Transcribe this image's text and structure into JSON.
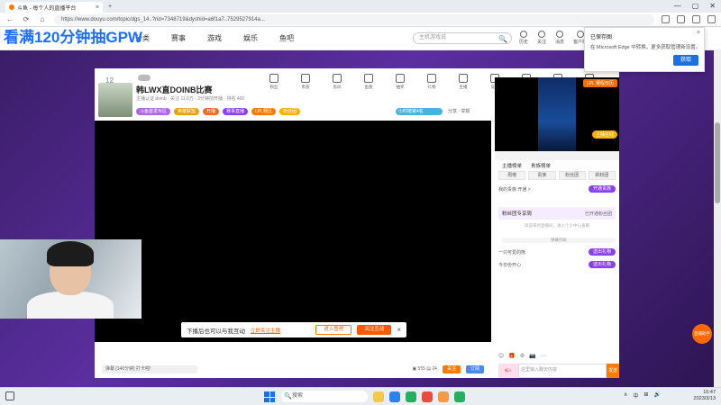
{
  "browser": {
    "tab_title": "斗鱼 - 每个人的直播平台",
    "new_tab": "+",
    "tab_close": "×",
    "url": "https://www.douyu.com/topic/dgs_14..?rid=7348719&dyshid=a6f1a7..7529527914a...",
    "nav": {
      "back": "←",
      "refresh": "⟳",
      "home": "⌂"
    },
    "window_controls": [
      "—",
      "▢",
      "✕"
    ]
  },
  "overlay_title": "看满120分钟抽GPW",
  "site": {
    "nav": [
      "分类",
      "赛事",
      "游戏",
      "娱乐",
      "鱼吧"
    ],
    "search_placeholder": "主机游戏说",
    "search_icon": "🔍",
    "header_icons": [
      "历史",
      "关注",
      "消息",
      "客户端",
      "登录"
    ]
  },
  "notification": {
    "title": "已保存图",
    "body": "在 Microsoft Edge 中转换，更多获取管理新设置。",
    "button": "获取",
    "close": "×"
  },
  "room": {
    "level": "12",
    "title": "韩LWX直DOINB比赛",
    "meta": "主播认证 doinb · 关注 11.6万 · 2分钟前开播 · 排名 400",
    "tags": [
      {
        "label": "斗鱼首发专区",
        "color": "#b065e8"
      },
      {
        "label": "英雄联盟",
        "color": "#e8a017"
      },
      {
        "label": "开播",
        "color": "#f06a2a"
      },
      {
        "label": "赛事直播",
        "color": "#8a3ff0"
      },
      {
        "label": "LPL赛区",
        "color": "#ff7a00"
      },
      {
        "label": "粉丝团",
        "color": "#ffb000"
      }
    ],
    "tools": [
      "粉丝",
      "贵族",
      "房间",
      "鱼翅",
      "抽奖",
      "礼物",
      "主播",
      "竞猜",
      "精彩",
      "AR",
      "连麦"
    ],
    "rank_pill": "小时榜第4名",
    "share": "分享 · 举报",
    "popup": {
      "text": "下播后也可以与我互动",
      "link": "立即关注主播",
      "btn_outline": "进入鱼吧",
      "btn_fill": "关注互动",
      "close": "×"
    },
    "footer": {
      "left": "弹幕 [140分钟] 打卡啦!",
      "stats": "▣ 555  ▤ 24",
      "btn1": "关注",
      "btn2": "订阅"
    }
  },
  "side": {
    "top_badge": "LPL 赛程日历",
    "bottom_badge": "主播在线",
    "tabs_top": [
      "主播榜单",
      "贵族榜单"
    ],
    "tabs": [
      "周榜",
      "贵族",
      "粉丝团",
      "新粉团"
    ],
    "row1_text": "我的贵族 开通 >",
    "row1_btn": "开通贵族",
    "banner": "粉丝团专享周",
    "banner_right": "已开通粉丝团",
    "note": "欢迎来到直播间，进入个人中心查看",
    "note2": "弹幕列表",
    "chat_rows": [
      {
        "text": "一只可爱的熊",
        "btn": "送出礼物"
      },
      {
        "text": "今日份开心",
        "btn": "送出礼物"
      }
    ],
    "chat_tools": [
      "😊",
      "🎁",
      "⚙",
      "📷",
      "⋯"
    ],
    "chat_avatar": "新人",
    "chat_placeholder": "这里输入聊天内容",
    "send": "发送"
  },
  "float_button": "直播助手",
  "taskbar": {
    "search_placeholder": "搜索",
    "search_icon": "🔍",
    "apps": [
      "#f2c94c",
      "#2f80ed",
      "#27ae60",
      "#e74c3c",
      "#f2994a",
      "#27ae60"
    ],
    "tray": [
      "∧",
      "中",
      "⊞",
      "🔊"
    ],
    "time": "15:47",
    "date": "2023/3/13"
  }
}
